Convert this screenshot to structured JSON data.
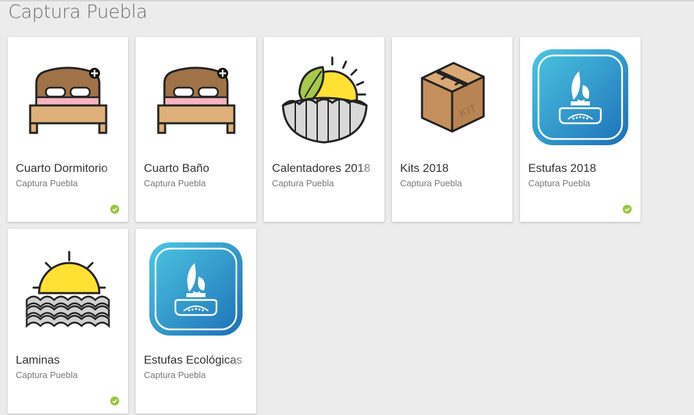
{
  "header": {
    "title": "Captura Puebla"
  },
  "colors": {
    "background": "#ececec",
    "card": "#ffffff",
    "check": "#9bc53d",
    "stove_blue": "#2186c8",
    "sun_yellow": "#ffe033"
  },
  "cards": [
    {
      "name": "Cuarto Dormitorio",
      "subtitle": "Captura Puebla",
      "icon": "bed-icon",
      "checked": true
    },
    {
      "name": "Cuarto Baño",
      "subtitle": "Captura Puebla",
      "icon": "bed-icon",
      "checked": false
    },
    {
      "name": "Calentadores 2018",
      "subtitle": "Captura Puebla",
      "icon": "solar-heater-icon",
      "checked": false
    },
    {
      "name": "Kits 2018",
      "subtitle": "Captura Puebla",
      "icon": "box-kit-icon",
      "checked": false
    },
    {
      "name": "Estufas 2018",
      "subtitle": "Captura Puebla",
      "icon": "stove-icon",
      "checked": true
    },
    {
      "name": "Laminas",
      "subtitle": "Captura Puebla",
      "icon": "sun-waves-icon",
      "checked": true
    },
    {
      "name": "Estufas Ecológicas",
      "subtitle": "Captura Puebla",
      "icon": "stove-icon",
      "checked": false
    }
  ],
  "icon_labels": {
    "kit_box": "KIT"
  }
}
